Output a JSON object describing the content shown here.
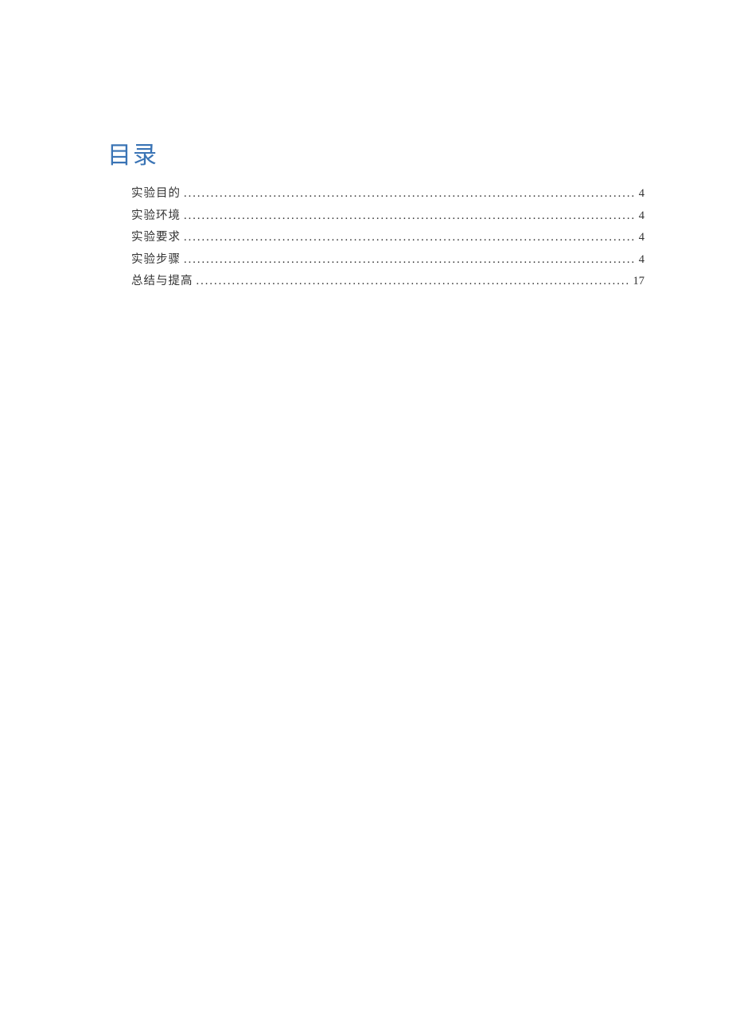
{
  "toc": {
    "title": "目录",
    "entries": [
      {
        "label": "实验目的",
        "page": "4"
      },
      {
        "label": "实验环境",
        "page": "4"
      },
      {
        "label": "实验要求",
        "page": "4"
      },
      {
        "label": "实验步骤",
        "page": "4"
      },
      {
        "label": "总结与提高",
        "page": "17"
      }
    ]
  }
}
